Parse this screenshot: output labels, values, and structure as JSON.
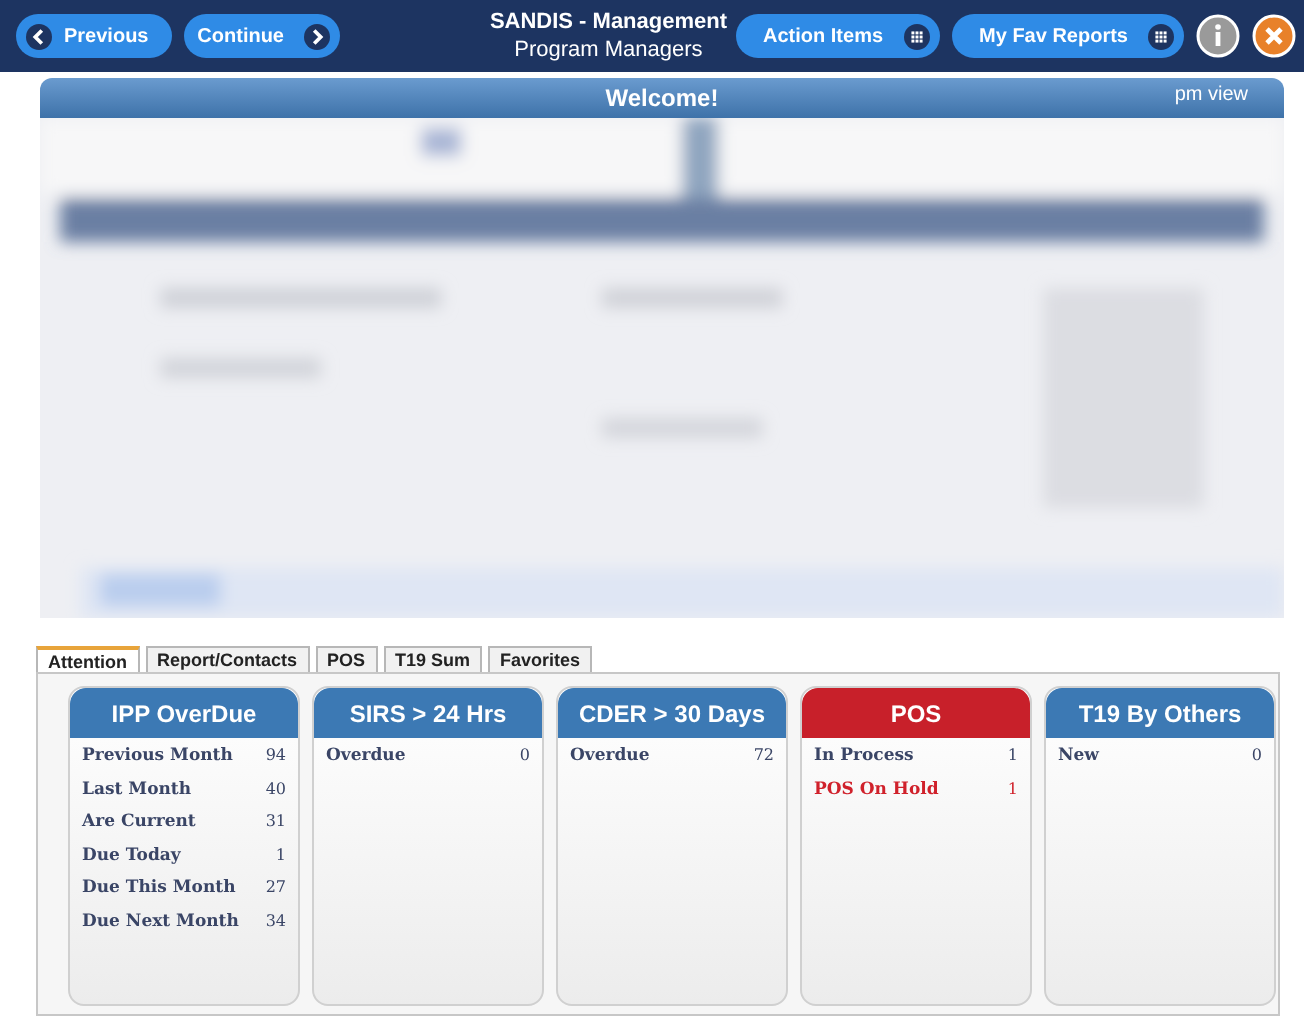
{
  "toolbar": {
    "left_buttons": [
      {
        "label": "Previous"
      },
      {
        "label": "Continue"
      }
    ],
    "title": "SANDIS - Management",
    "subtitle": "Program Managers",
    "right_buttons": [
      {
        "label": "Action Items"
      },
      {
        "label": "My Fav Reports"
      }
    ]
  },
  "welcome": {
    "title": "Welcome!",
    "view": "pm view"
  },
  "tabs": [
    {
      "label": "Attention",
      "selected": true
    },
    {
      "label": "Report/Contacts",
      "selected": false
    },
    {
      "label": "POS",
      "selected": false
    },
    {
      "label": "T19 Sum",
      "selected": false
    },
    {
      "label": "Favorites",
      "selected": false
    }
  ],
  "cards": [
    {
      "title": "IPP OverDue",
      "color": "#3c79b4",
      "rows": [
        {
          "label": "Previous Month",
          "count": "94",
          "alert": false
        },
        {
          "label": "Last Month",
          "count": "40",
          "alert": false
        },
        {
          "label": "Are Current",
          "count": "31",
          "alert": false
        },
        {
          "label": "Due Today",
          "count": "1",
          "alert": false
        },
        {
          "label": "Due This Month",
          "count": "27",
          "alert": false
        },
        {
          "label": "Due Next Month",
          "count": "34",
          "alert": false
        }
      ]
    },
    {
      "title": "SIRS > 24 Hrs",
      "color": "#3c79b4",
      "rows": [
        {
          "label": "Overdue",
          "count": "0",
          "alert": false
        }
      ]
    },
    {
      "title": "CDER > 30 Days",
      "color": "#3c79b4",
      "rows": [
        {
          "label": "Overdue",
          "count": "72",
          "alert": false
        }
      ]
    },
    {
      "title": "POS",
      "color": "#c8202a",
      "rows": [
        {
          "label": "In Process",
          "count": "1",
          "alert": false
        },
        {
          "label": "POS On Hold",
          "count": "1",
          "alert": true
        }
      ]
    },
    {
      "title": "T19 By Others",
      "color": "#3c79b4",
      "rows": [
        {
          "label": "New",
          "count": "0",
          "alert": false
        }
      ]
    }
  ]
}
